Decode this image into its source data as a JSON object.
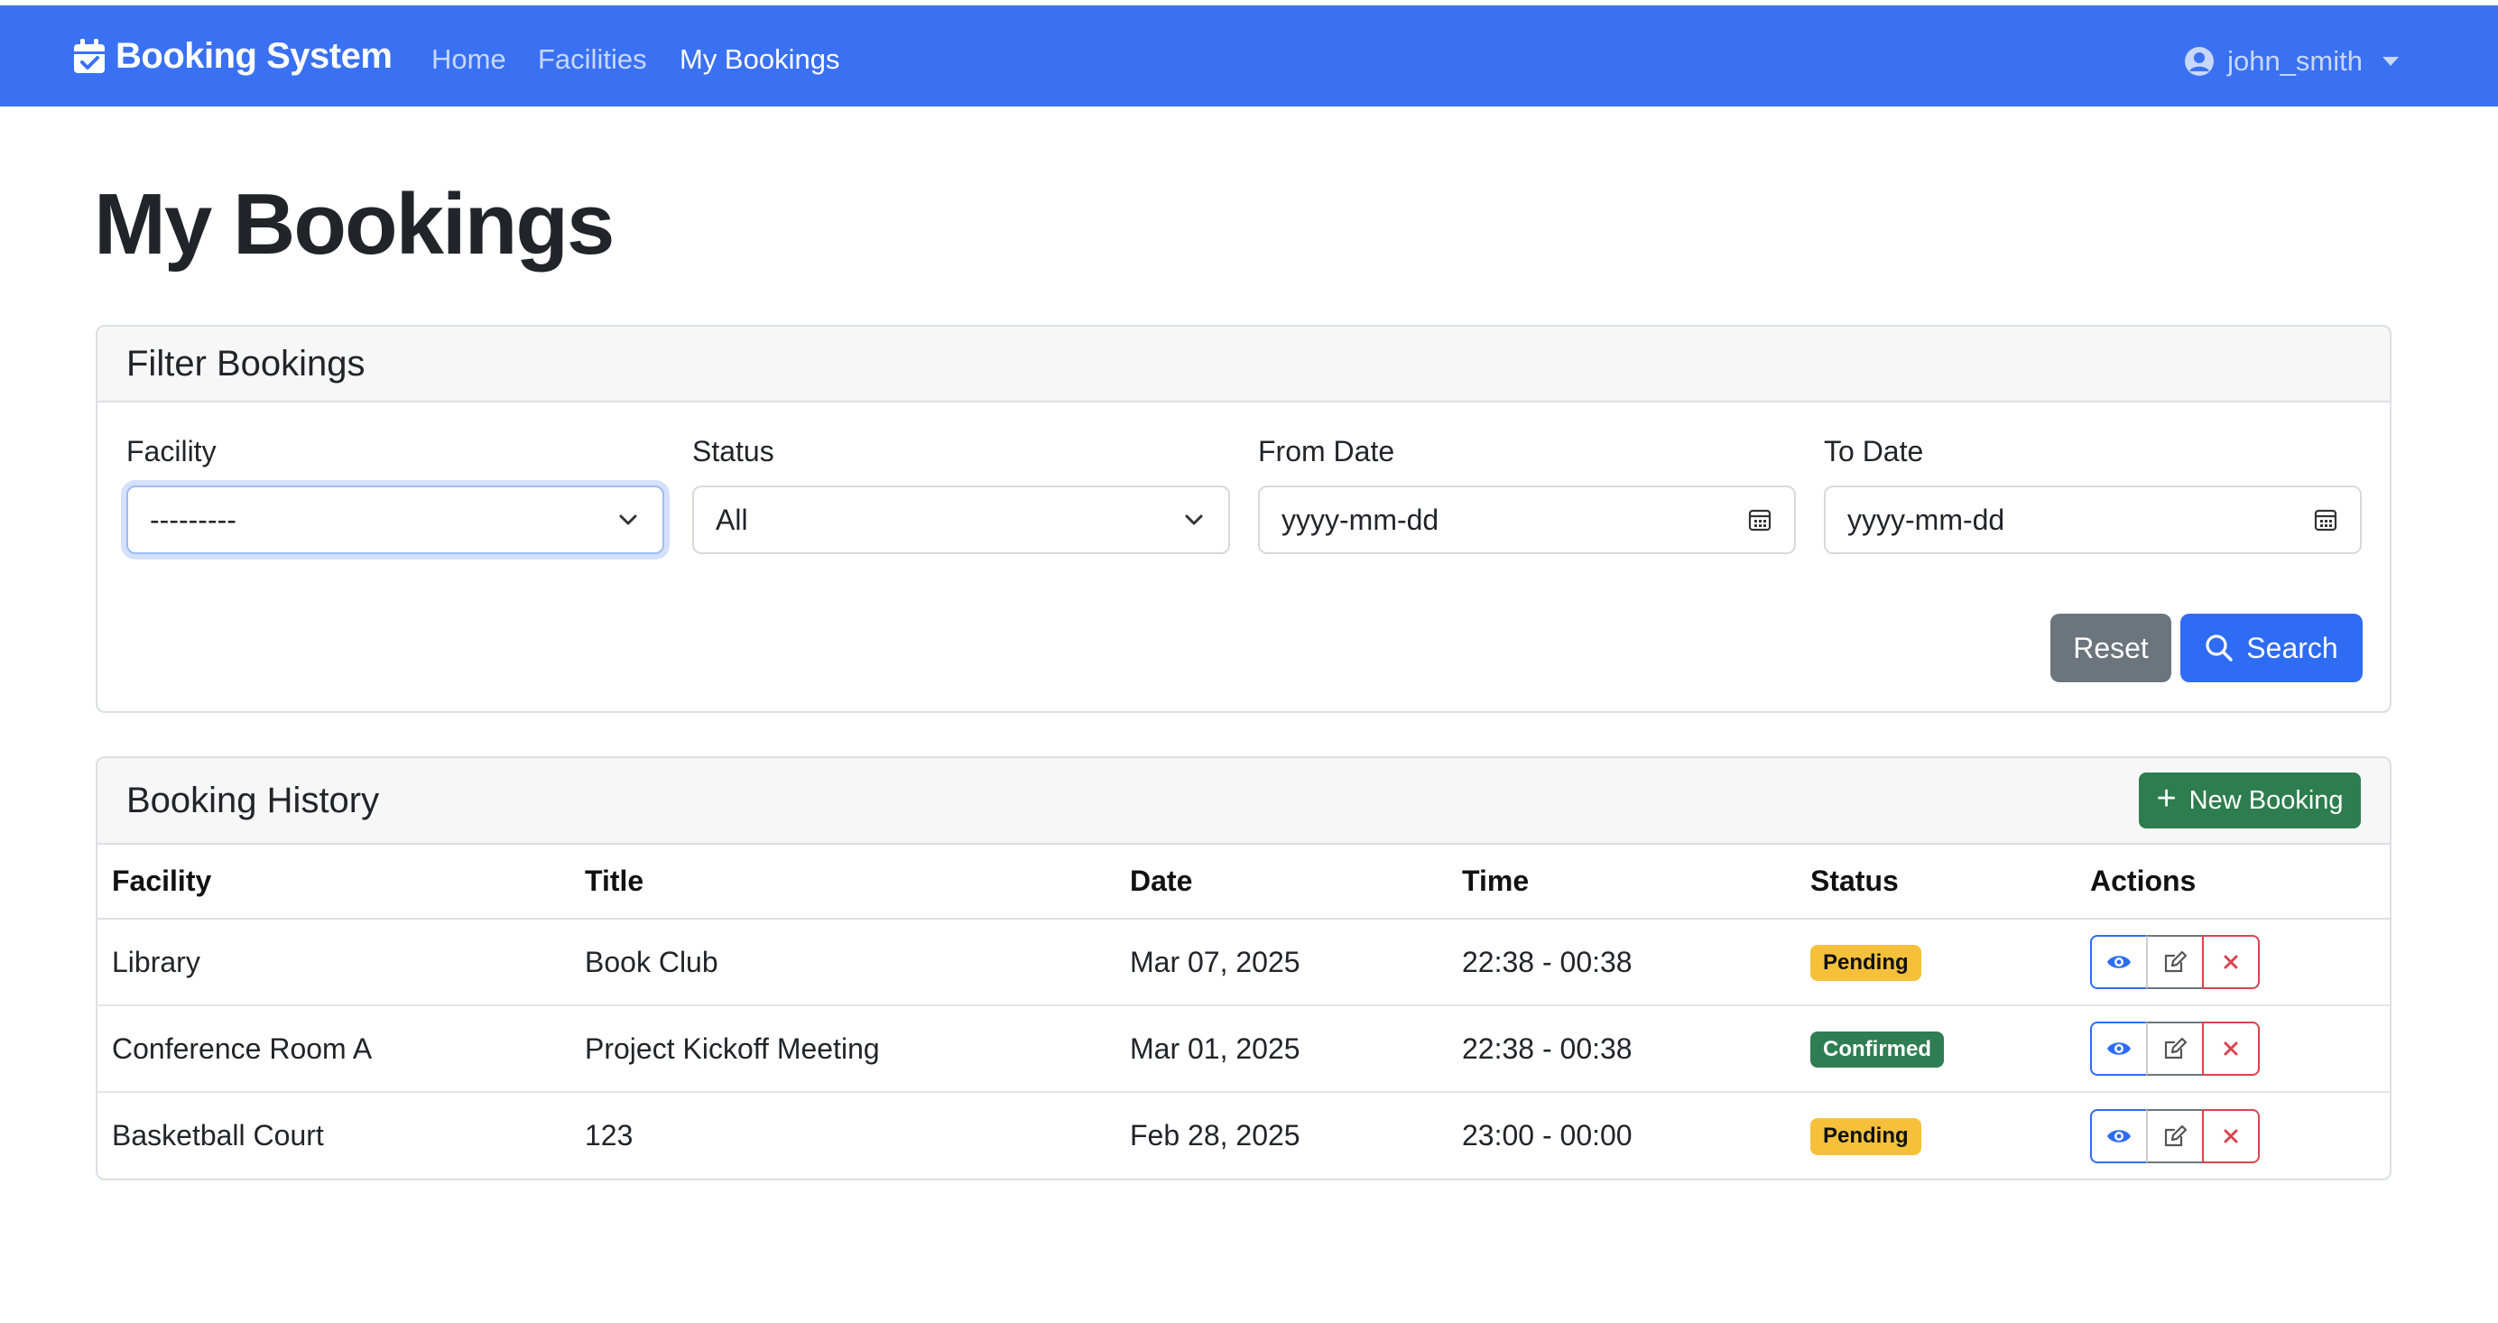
{
  "nav": {
    "brand": "Booking System",
    "links": [
      "Home",
      "Facilities",
      "My Bookings"
    ],
    "active_link": "My Bookings",
    "user": "john_smith"
  },
  "page": {
    "title": "My Bookings"
  },
  "filter": {
    "title": "Filter Bookings",
    "facility_label": "Facility",
    "facility_value": "---------",
    "status_label": "Status",
    "status_value": "All",
    "from_label": "From Date",
    "from_placeholder": "yyyy-mm-dd",
    "to_label": "To Date",
    "to_placeholder": "yyyy-mm-dd",
    "reset_label": "Reset",
    "search_label": "Search"
  },
  "bookings": {
    "title": "Booking History",
    "new_label": "New Booking",
    "columns": [
      "Facility",
      "Title",
      "Date",
      "Time",
      "Status",
      "Actions"
    ],
    "rows": [
      {
        "facility": "Library",
        "title": "Book Club",
        "date": "Mar 07, 2025",
        "time": "22:38 - 00:38",
        "status": "Pending"
      },
      {
        "facility": "Conference Room A",
        "title": "Project Kickoff Meeting",
        "date": "Mar 01, 2025",
        "time": "22:38 - 00:38",
        "status": "Confirmed"
      },
      {
        "facility": "Basketball Court",
        "title": "123",
        "date": "Feb 28, 2025",
        "time": "23:00 - 00:00",
        "status": "Pending"
      }
    ]
  },
  "colors": {
    "navbar": "#3a71f2",
    "primary": "#2f6cf4",
    "secondary": "#6c757d",
    "success": "#2e7d4f",
    "warning": "#f5c13b",
    "danger": "#d9434e"
  }
}
